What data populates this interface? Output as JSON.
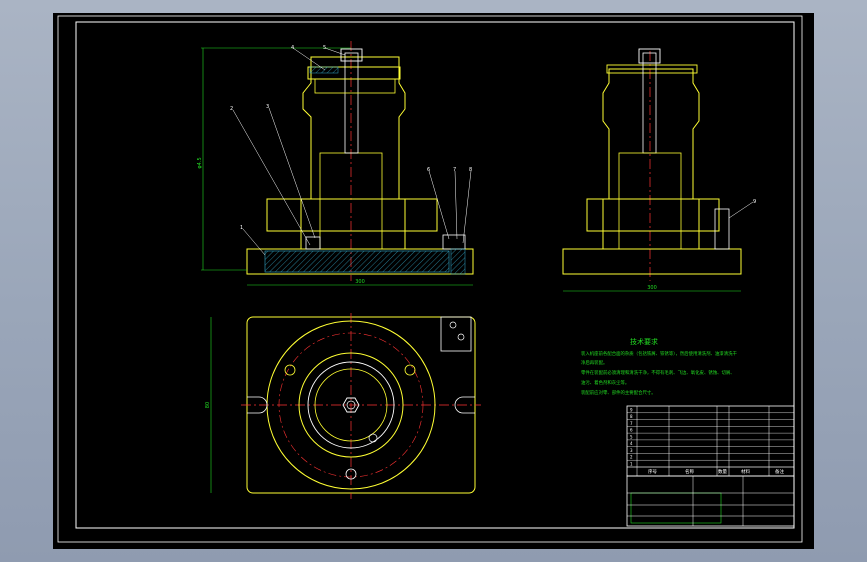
{
  "notes": {
    "title": "技术要求",
    "lines": [
      "装入机座前各配合面的杂质（包括铁屑、铁锈等），然后使用清洗剂、油漆清洗干",
      "净后再装配。",
      "零件在装配前必须清理和清洗干净，不得有毛刺、飞边、氧化皮、锈蚀、切屑、",
      "油污、着色剂和灰尘等。",
      "装配前应对零、部件的主要配合尺寸。"
    ]
  },
  "colors": {
    "frame": "#ffffff",
    "outline": "#ffff33",
    "hatch": "#33aacc",
    "center": "#ff3333",
    "dim": "#22dd22",
    "leader": "#ffffff"
  },
  "balloons": {
    "front_top": [
      "4",
      "5"
    ],
    "front_left": [
      "2",
      "3"
    ],
    "front_base": "1",
    "front_right": [
      "6",
      "7",
      "8"
    ],
    "side_right": "9"
  },
  "dimensions": {
    "front_height": "φ4.5",
    "front_width": "300",
    "side_width": "300",
    "plan_height": "80"
  },
  "title_block": {
    "headers": [
      "序号",
      "名称",
      "数量",
      "材料",
      "备注"
    ],
    "rows": [
      "9",
      "8",
      "7",
      "6",
      "5",
      "4",
      "3",
      "2",
      "1"
    ]
  }
}
